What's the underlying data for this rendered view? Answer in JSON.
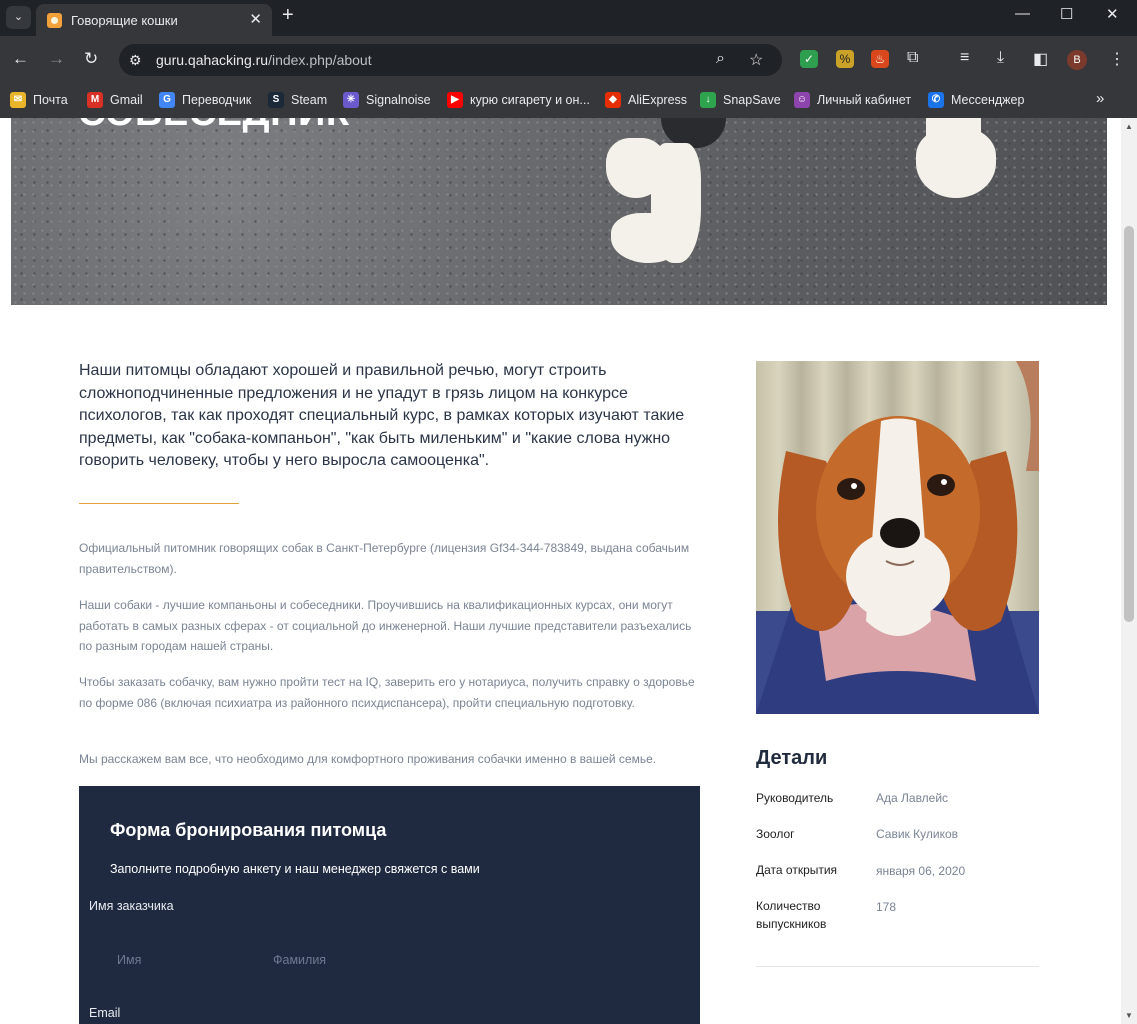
{
  "browser": {
    "tab_title": "Говорящие кошки",
    "url_host": "guru.qahacking.ru",
    "url_path": "/index.php/about",
    "avatar_letter": "B",
    "bookmarks": [
      {
        "label": "Почта",
        "icon": "mail-icon",
        "color": "#e8b52a"
      },
      {
        "label": "Gmail",
        "icon": "gmail-icon",
        "color": "#d93025"
      },
      {
        "label": "Переводчик",
        "icon": "translate-icon",
        "color": "#4285f4"
      },
      {
        "label": "Steam",
        "icon": "steam-icon",
        "color": "#1b2838"
      },
      {
        "label": "Signalnoise",
        "icon": "signalnoise-icon",
        "color": "#6a5acd"
      },
      {
        "label": "курю сигарету и он...",
        "icon": "youtube-icon",
        "color": "#ff0000"
      },
      {
        "label": "AliExpress",
        "icon": "aliexpress-icon",
        "color": "#e62e04"
      },
      {
        "label": "SnapSave",
        "icon": "snapsave-icon",
        "color": "#2ea44f"
      },
      {
        "label": "Личный кабинет",
        "icon": "user-icon",
        "color": "#8e44ad"
      },
      {
        "label": "Мессенджер",
        "icon": "messenger-icon",
        "color": "#1a73e8"
      }
    ]
  },
  "hero": {
    "title": "СОБЕСЕДНИК"
  },
  "about": {
    "lead": "Наши питомцы обладают хорошей и правильной речью, могут строить сложноподчиненные предложения и не упадут в грязь лицом на конкурсе психологов, так как проходят специальный курс, в рамках которых изучают такие предметы, как \"собака-компаньон\", \"как быть миленьким\" и \"какие слова нужно говорить человеку, чтобы у него выросла самооценка\".",
    "paragraphs": [
      "Официальный питомник говорящих собак в Санкт-Петербурге (лицензия Gf34-344-783849, выдана собачьим правительством).",
      "Наши собаки - лучшие компаньоны и собеседники. Проучившись на квалификационных курсах, они могут работать в самых разных сферах - от социальной до инженерной. Наши лучшие представители разъехались по разным городам нашей страны.",
      "Чтобы заказать собачку, вам нужно пройти тест на IQ, заверить его у нотариуса, получить справку о здоровье по форме 086 (включая психиатра из районного психдиспансера), пройти специальную подготовку.",
      "Мы расскажем вам все, что необходимо для комфортного проживания собачки именно в вашей семье."
    ]
  },
  "details": {
    "title": "Детали",
    "rows": [
      {
        "label": "Руководитель",
        "value": "Ада Лавлейс"
      },
      {
        "label": "Зоолог",
        "value": "Савик Куликов"
      },
      {
        "label": "Дата открытия",
        "value": "января 06, 2020"
      },
      {
        "label": "Количество выпускников",
        "value": "178"
      }
    ]
  },
  "form": {
    "title": "Форма бронирования питомца",
    "subtitle": "Заполните подробную анкету и наш менеджер свяжется с вами",
    "customer_label": "Имя заказчика",
    "first_name_placeholder": "Имя",
    "last_name_placeholder": "Фамилия",
    "email_label": "Email"
  }
}
